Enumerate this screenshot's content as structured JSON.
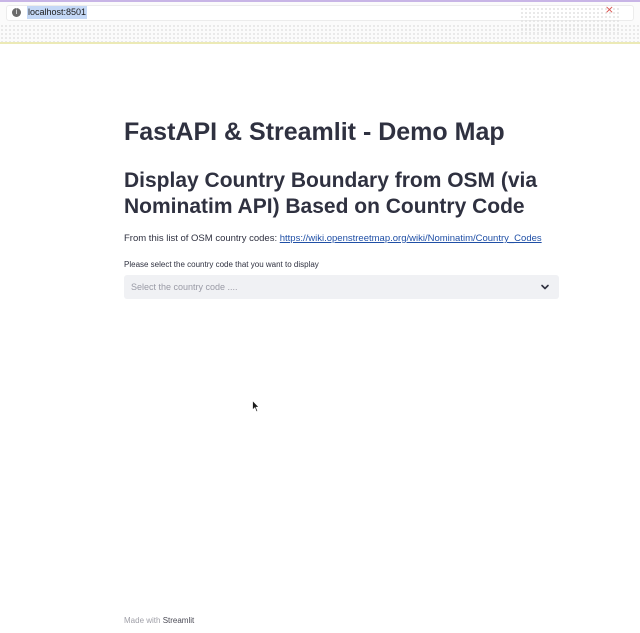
{
  "browser": {
    "url": "localhost:8501",
    "info_icon_glyph": "i",
    "close_glyph": "×",
    "accent_color": "#c8b5e6"
  },
  "main": {
    "title": "FastAPI & Streamlit - Demo Map",
    "subtitle": "Display Country Boundary from OSM (via Nominatim API) Based on Country Code",
    "intro_text": "From this list of OSM country codes: ",
    "intro_link": "https://wiki.openstreetmap.org/wiki/Nominatim/Country_Codes",
    "select_label": "Please select the country code that you want to display",
    "select_placeholder": "Select the country code ...."
  },
  "footer": {
    "prefix": "Made with ",
    "brand": "Streamlit"
  }
}
